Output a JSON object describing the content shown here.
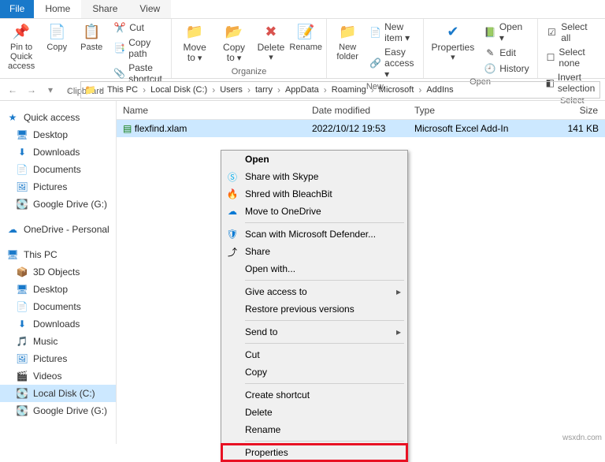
{
  "tabs": {
    "file": "File",
    "home": "Home",
    "share": "Share",
    "view": "View"
  },
  "ribbon": {
    "clipboard": {
      "label": "Clipboard",
      "pin": "Pin to Quick access",
      "copy": "Copy",
      "paste": "Paste",
      "cut": "Cut",
      "copy_path": "Copy path",
      "paste_shortcut": "Paste shortcut"
    },
    "organize": {
      "label": "Organize",
      "move_to": "Move to",
      "copy_to": "Copy to",
      "delete": "Delete",
      "rename": "Rename"
    },
    "new": {
      "label": "New",
      "new_folder": "New folder",
      "new_item": "New item",
      "easy_access": "Easy access"
    },
    "open": {
      "label": "Open",
      "properties": "Properties",
      "open": "Open",
      "edit": "Edit",
      "history": "History"
    },
    "select": {
      "label": "Select",
      "select_all": "Select all",
      "select_none": "Select none",
      "invert": "Invert selection"
    }
  },
  "breadcrumb": [
    "This PC",
    "Local Disk (C:)",
    "Users",
    "tarry",
    "AppData",
    "Roaming",
    "Microsoft",
    "AddIns"
  ],
  "columns": {
    "name": "Name",
    "date": "Date modified",
    "type": "Type",
    "size": "Size"
  },
  "file": {
    "name": "flexfind.xlam",
    "date": "2022/10/12 19:53",
    "type": "Microsoft Excel Add-In",
    "size": "141 KB"
  },
  "sidebar": {
    "quick": "Quick access",
    "desktop": "Desktop",
    "downloads": "Downloads",
    "documents": "Documents",
    "pictures": "Pictures",
    "gdrive": "Google Drive (G:)",
    "onedrive": "OneDrive - Personal",
    "thispc": "This PC",
    "objects3d": "3D Objects",
    "desktop2": "Desktop",
    "documents2": "Documents",
    "downloads2": "Downloads",
    "music": "Music",
    "pictures2": "Pictures",
    "videos": "Videos",
    "localdisk": "Local Disk (C:)",
    "gdrive2": "Google Drive (G:)"
  },
  "context_menu": {
    "open": "Open",
    "skype": "Share with Skype",
    "bleachbit": "Shred with BleachBit",
    "onedrive": "Move to OneDrive",
    "defender": "Scan with Microsoft Defender...",
    "share": "Share",
    "open_with": "Open with...",
    "give_access": "Give access to",
    "restore": "Restore previous versions",
    "send_to": "Send to",
    "cut": "Cut",
    "copy": "Copy",
    "create_shortcut": "Create shortcut",
    "delete": "Delete",
    "rename": "Rename",
    "properties": "Properties"
  },
  "watermark": "wsxdn.com"
}
